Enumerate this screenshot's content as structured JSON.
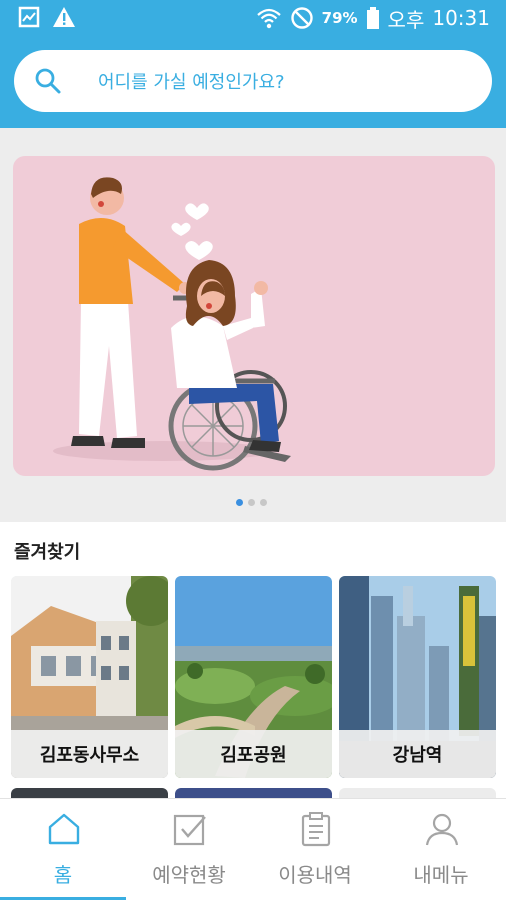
{
  "status_bar": {
    "battery_percent": "79%",
    "ampm": "오후",
    "time": "10:31",
    "icons": [
      "gallery-icon",
      "warning-icon",
      "wifi-icon",
      "do-not-disturb-icon",
      "battery-icon"
    ]
  },
  "search": {
    "placeholder": "어디를 가실 예정인가요?"
  },
  "banner": {
    "page_count": 3,
    "active_page": 1
  },
  "favorites": {
    "title": "즐겨찾기",
    "items": [
      {
        "label": "김포동사무소"
      },
      {
        "label": "김포공원"
      },
      {
        "label": "강남역"
      }
    ]
  },
  "tabs": [
    {
      "label": "홈",
      "icon": "home-icon",
      "active": true
    },
    {
      "label": "예약현황",
      "icon": "checkbox-icon",
      "active": false
    },
    {
      "label": "이용내역",
      "icon": "clipboard-icon",
      "active": false
    },
    {
      "label": "내메뉴",
      "icon": "person-icon",
      "active": false
    }
  ],
  "colors": {
    "primary": "#39aee1",
    "banner_bg": "#f0ccd7",
    "dot_active": "#3a8fe0"
  }
}
